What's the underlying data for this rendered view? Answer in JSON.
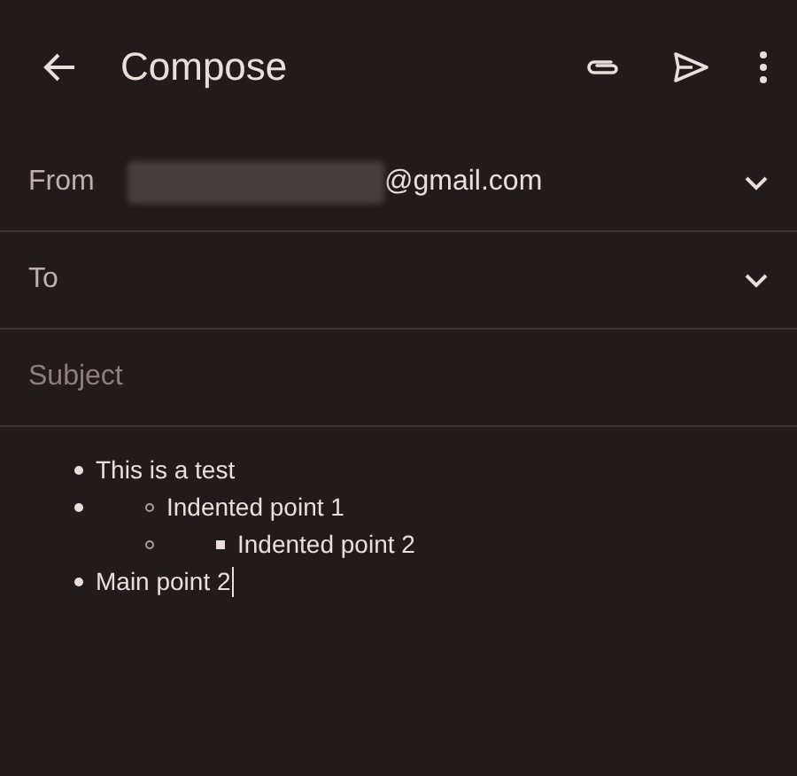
{
  "header": {
    "title": "Compose"
  },
  "fields": [
    {
      "label": "From",
      "value": "@gmail.com",
      "redacted": true,
      "dropdown": true
    },
    {
      "label": "To",
      "dropdown": true
    },
    {
      "placeholder": "Subject",
      "dropdown": false
    }
  ],
  "body": {
    "items": [
      {
        "text": "This is a test"
      },
      {
        "children": [
          {
            "text": "Indented point 1"
          },
          {
            "children": [
              {
                "text": "Indented point 2"
              }
            ]
          }
        ]
      },
      {
        "text": "Main point 2",
        "cursor": true
      }
    ]
  }
}
